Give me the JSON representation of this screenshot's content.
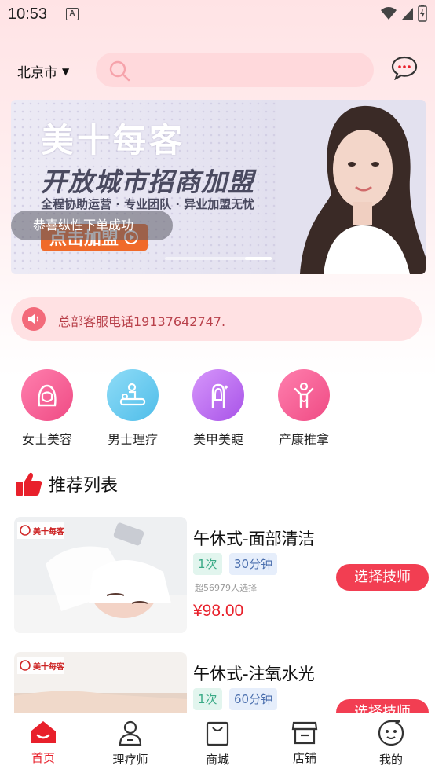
{
  "status": {
    "time": "10:53",
    "notif_letter": "A"
  },
  "header": {
    "city": "北京市",
    "search_placeholder": ""
  },
  "banner": {
    "brand": "美十每客",
    "headline": "开放城市招商加盟",
    "subline": "全程协助运营 · 专业团队 · 异业加盟无忧",
    "cta": "点击加盟",
    "toast": "恭喜纵性下单成功"
  },
  "notice": {
    "text": "总部客服电话19137642747."
  },
  "categories": [
    {
      "label": "女士美容",
      "icon": "woman-face-icon",
      "color": "#f25c8e"
    },
    {
      "label": "男士理疗",
      "icon": "massage-icon",
      "color": "#5fc7ee"
    },
    {
      "label": "美甲美睫",
      "icon": "nail-icon",
      "color": "#c070f0"
    },
    {
      "label": "产康推拿",
      "icon": "postpartum-icon",
      "color": "#f25c8e"
    }
  ],
  "recommend": {
    "title": "推荐列表",
    "items": [
      {
        "name": "午休式-面部清洁",
        "count": "1次",
        "duration": "30分钟",
        "sold": "超56979人选择",
        "price": "¥98.00",
        "button": "选择技师",
        "logo": "美十每客"
      },
      {
        "name": "午休式-注氧水光",
        "count": "1次",
        "duration": "60分钟",
        "sold": "",
        "price": "",
        "button": "选择技师",
        "logo": "美十每客"
      }
    ]
  },
  "tabs": [
    {
      "label": "首页",
      "icon": "home-icon",
      "active": true
    },
    {
      "label": "理疗师",
      "icon": "therapist-icon",
      "active": false
    },
    {
      "label": "商城",
      "icon": "shopping-bag-icon",
      "active": false
    },
    {
      "label": "店铺",
      "icon": "store-icon",
      "active": false
    },
    {
      "label": "我的",
      "icon": "profile-face-icon",
      "active": false
    }
  ],
  "colors": {
    "accent": "#e8202b",
    "button": "#f23e52",
    "header_bg": "#ffe3e5"
  }
}
